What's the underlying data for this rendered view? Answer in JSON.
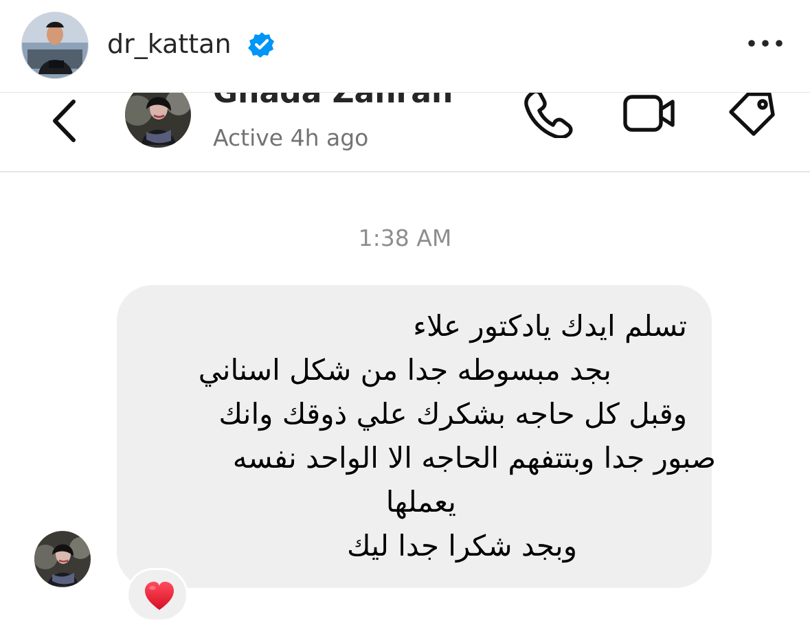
{
  "post": {
    "username": "dr_kattan",
    "verified_icon": "verified-badge-icon",
    "more_icon": "more-horizontal-icon"
  },
  "chat": {
    "contact_name": "Ghada Zahran",
    "status": "Active 4h ago",
    "header_icons": [
      "back-chevron-icon",
      "phone-call-icon",
      "video-camera-icon",
      "tag-icon"
    ]
  },
  "conversation": {
    "timestamp": "1:38 AM",
    "message_lines": [
      "تسلم ايدك يادكتور علاء",
      "بجد مبسوطه جدا من شكل اسناني",
      "وقبل كل حاجه بشكرك علي ذوقك وانك",
      "صبور جدا وبتتفهم الحاجه الا الواحد نفسه",
      "يعملها",
      "وبجد شكرا جدا ليك"
    ],
    "reaction": "❤️",
    "reaction_icon": "red-heart-icon"
  },
  "colors": {
    "bubble": "#efefef",
    "muted_text": "#737373",
    "verified_blue": "#0095f6",
    "heart_red": "#ed1d35"
  }
}
